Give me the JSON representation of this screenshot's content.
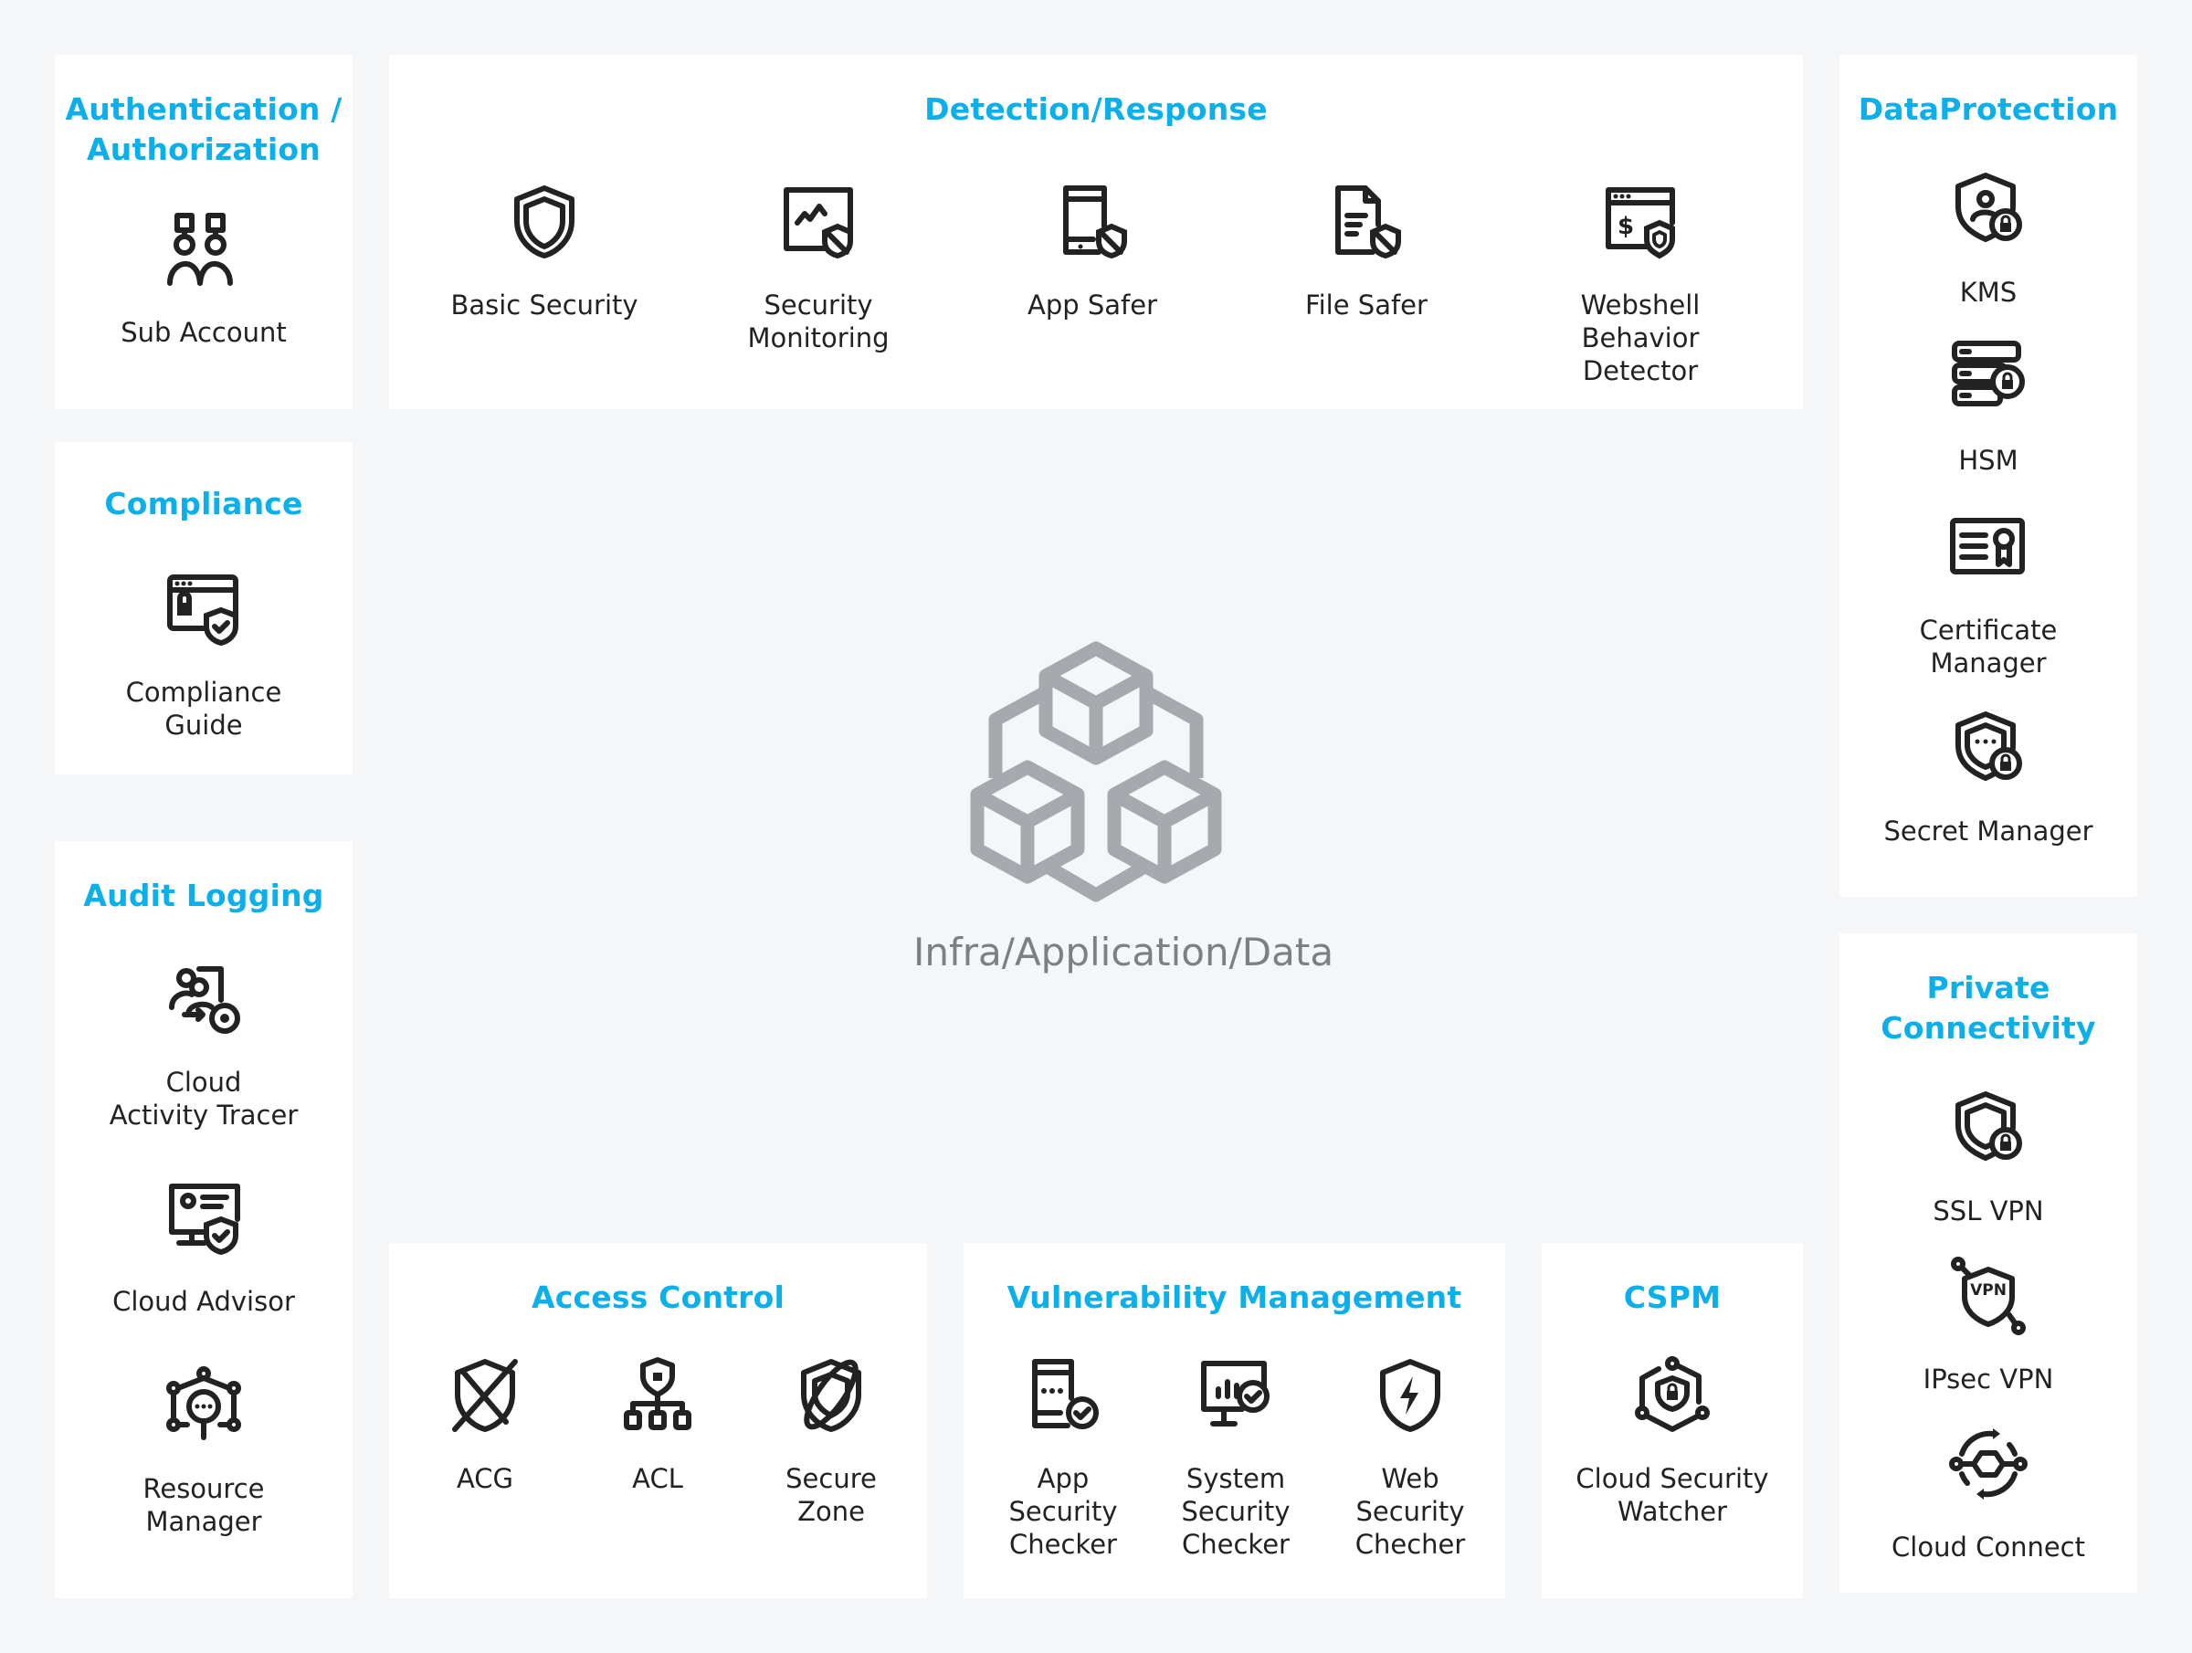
{
  "center": {
    "label": "Infra/Application/Data",
    "icon": "cubes-icon"
  },
  "panels": {
    "auth": {
      "title_line1": "Authentication /",
      "title_line2": "Authorization",
      "items": [
        {
          "label": "Sub Account",
          "icon": "sub-account-icon"
        }
      ]
    },
    "compliance": {
      "title": "Compliance",
      "items": [
        {
          "label": "Compliance\nGuide",
          "icon": "browser-lock-shield-icon"
        }
      ]
    },
    "audit": {
      "title": "Audit Logging",
      "items": [
        {
          "label": "Cloud\nActivity Tracer",
          "icon": "users-gear-icon"
        },
        {
          "label": "Cloud Advisor",
          "icon": "monitor-shield-check-icon"
        },
        {
          "label": "Resource\nManager",
          "icon": "network-search-icon"
        }
      ]
    },
    "detection": {
      "title": "Detection/Response",
      "items": [
        {
          "label": "Basic Security",
          "icon": "shield-icon"
        },
        {
          "label": "Security\nMonitoring",
          "icon": "monitor-chart-shield-icon"
        },
        {
          "label": "App Safer",
          "icon": "phone-shield-icon"
        },
        {
          "label": "File Safer",
          "icon": "file-shield-icon"
        },
        {
          "label": "Webshell\nBehavior Detector",
          "icon": "browser-dollar-shield-icon"
        }
      ]
    },
    "access": {
      "title": "Access Control",
      "items": [
        {
          "label": "ACG",
          "icon": "shield-cross-icon"
        },
        {
          "label": "ACL",
          "icon": "shield-tree-icon"
        },
        {
          "label": "Secure\nZone",
          "icon": "shield-orbit-icon"
        }
      ]
    },
    "vuln": {
      "title": "Vulnerability Management",
      "items": [
        {
          "label": "App\nSecurity\nChecker",
          "icon": "phone-check-icon"
        },
        {
          "label": "System\nSecurity\nChecker",
          "icon": "monitor-check-icon"
        },
        {
          "label": "Web\nSecurity\nChecher",
          "icon": "shield-bolt-icon"
        }
      ]
    },
    "cspm": {
      "title": "CSPM",
      "items": [
        {
          "label": "Cloud Security\nWatcher",
          "icon": "hex-shield-lock-icon"
        }
      ]
    },
    "dataprotection": {
      "title": "DataProtection",
      "items": [
        {
          "label": "KMS",
          "icon": "shield-user-lock-icon"
        },
        {
          "label": "HSM",
          "icon": "server-lock-icon"
        },
        {
          "label": "Certificate\nManager",
          "icon": "certificate-icon"
        },
        {
          "label": "Secret Manager",
          "icon": "shield-password-lock-icon"
        }
      ]
    },
    "private": {
      "title_line1": "Private",
      "title_line2": "Connectivity",
      "items": [
        {
          "label": "SSL VPN",
          "icon": "shield-lock-icon"
        },
        {
          "label": "IPsec VPN",
          "icon": "vpn-shield-icon"
        },
        {
          "label": "Cloud Connect",
          "icon": "hex-cycle-icon"
        }
      ]
    }
  },
  "colors": {
    "title": "#0BB0EA",
    "background": "#F5F6F8",
    "panel": "#FFFFFF",
    "icon": "#222222",
    "center": "#A6AAAF"
  }
}
